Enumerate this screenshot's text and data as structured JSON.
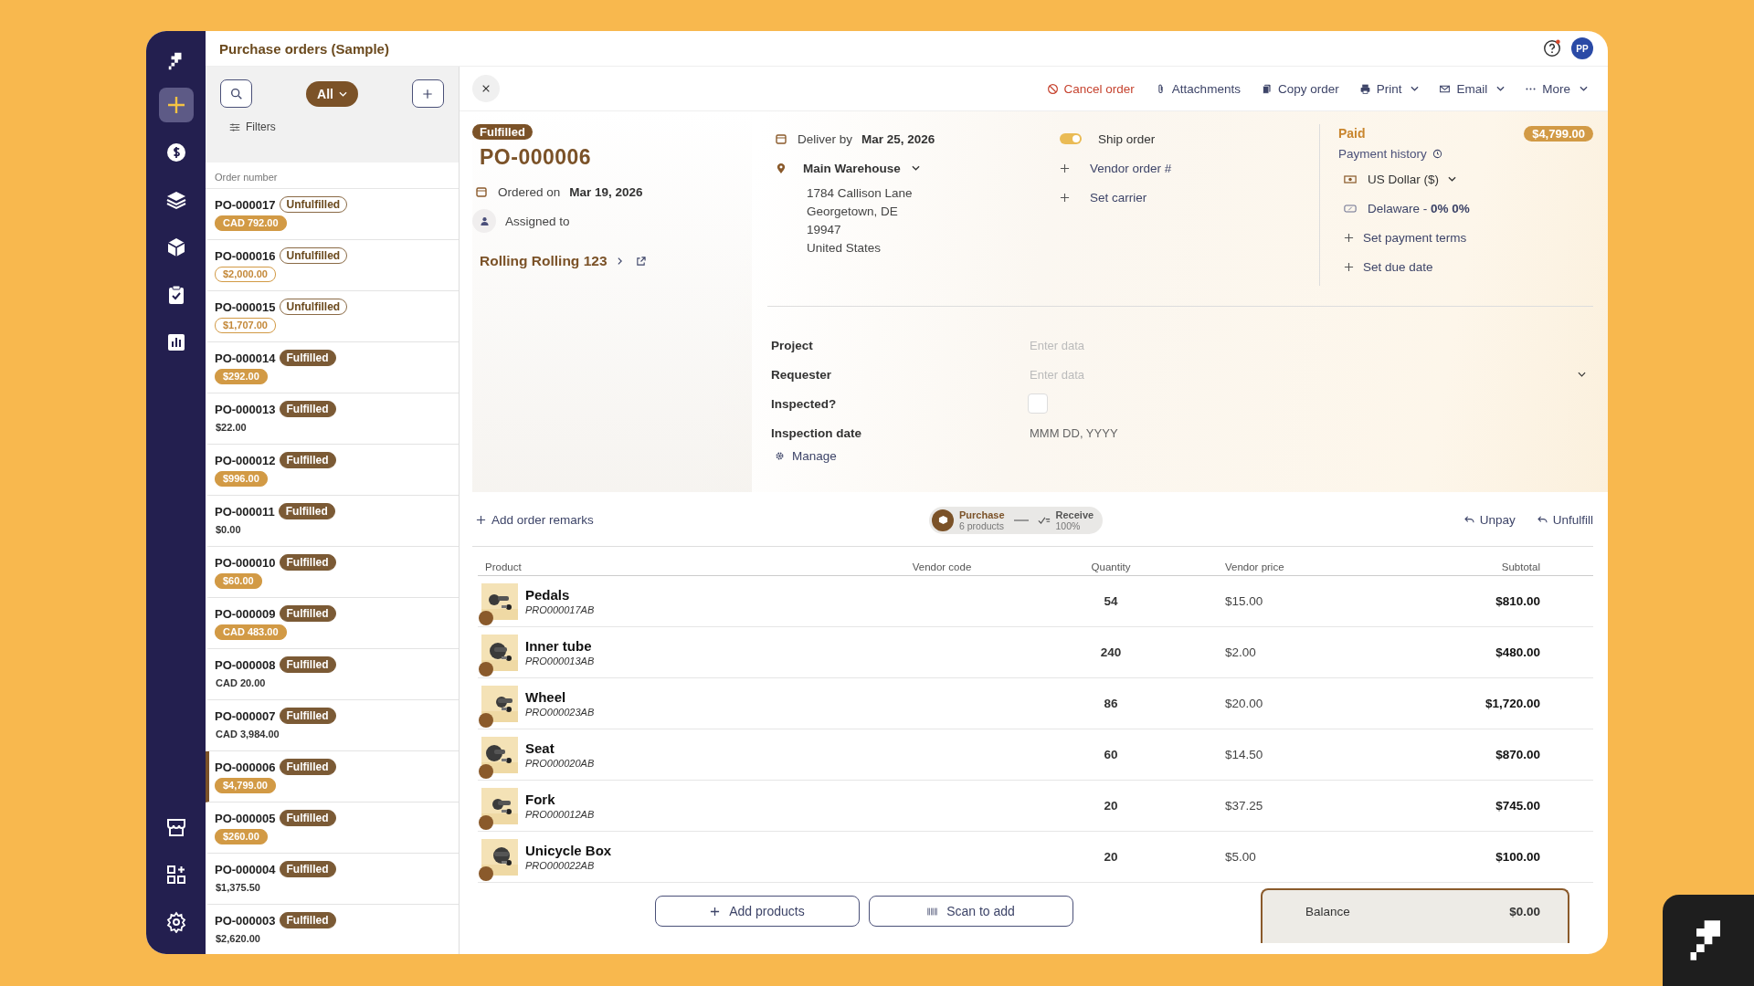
{
  "app": {
    "title": "Purchase orders (Sample)",
    "avatar": "PP"
  },
  "nav": [
    {
      "kind": "add",
      "selected": true
    },
    {
      "kind": "money",
      "selected": false
    },
    {
      "kind": "layers",
      "selected": false
    },
    {
      "kind": "box",
      "selected": false
    },
    {
      "kind": "clipboard",
      "selected": false
    },
    {
      "kind": "chart",
      "selected": false
    }
  ],
  "nav_bottom": [
    {
      "kind": "store",
      "selected": false
    },
    {
      "kind": "apps",
      "selected": false
    },
    {
      "kind": "settings",
      "selected": false
    }
  ],
  "list": {
    "filter": "All",
    "filters_label": "Filters",
    "column": "Order number",
    "orders": [
      {
        "number": "PO-000017",
        "status": "Unfulfilled",
        "fulfilled": false,
        "amount": {
          "text": "CAD 792.00",
          "kind": "solid"
        },
        "selected": false
      },
      {
        "number": "PO-000016",
        "status": "Unfulfilled",
        "fulfilled": false,
        "amount": {
          "text": "$2,000.00",
          "kind": "outline"
        },
        "selected": false
      },
      {
        "number": "PO-000015",
        "status": "Unfulfilled",
        "fulfilled": false,
        "amount": {
          "text": "$1,707.00",
          "kind": "outline"
        },
        "selected": false
      },
      {
        "number": "PO-000014",
        "status": "Fulfilled",
        "fulfilled": true,
        "amount": {
          "text": "$292.00",
          "kind": "solid"
        },
        "selected": false
      },
      {
        "number": "PO-000013",
        "status": "Fulfilled",
        "fulfilled": true,
        "amount": {
          "text": "$22.00",
          "kind": "plain"
        },
        "selected": false
      },
      {
        "number": "PO-000012",
        "status": "Fulfilled",
        "fulfilled": true,
        "amount": {
          "text": "$996.00",
          "kind": "solid"
        },
        "selected": false
      },
      {
        "number": "PO-000011",
        "status": "Fulfilled",
        "fulfilled": true,
        "amount": {
          "text": "$0.00",
          "kind": "plain"
        },
        "selected": false
      },
      {
        "number": "PO-000010",
        "status": "Fulfilled",
        "fulfilled": true,
        "amount": {
          "text": "$60.00",
          "kind": "solid"
        },
        "selected": false
      },
      {
        "number": "PO-000009",
        "status": "Fulfilled",
        "fulfilled": true,
        "amount": {
          "text": "CAD 483.00",
          "kind": "solid"
        },
        "selected": false
      },
      {
        "number": "PO-000008",
        "status": "Fulfilled",
        "fulfilled": true,
        "amount": {
          "text": "CAD 20.00",
          "kind": "plain"
        },
        "selected": false
      },
      {
        "number": "PO-000007",
        "status": "Fulfilled",
        "fulfilled": true,
        "amount": {
          "text": "CAD 3,984.00",
          "kind": "plain"
        },
        "selected": false
      },
      {
        "number": "PO-000006",
        "status": "Fulfilled",
        "fulfilled": true,
        "amount": {
          "text": "$4,799.00",
          "kind": "solid"
        },
        "selected": true
      },
      {
        "number": "PO-000005",
        "status": "Fulfilled",
        "fulfilled": true,
        "amount": {
          "text": "$260.00",
          "kind": "solid"
        },
        "selected": false
      },
      {
        "number": "PO-000004",
        "status": "Fulfilled",
        "fulfilled": true,
        "amount": {
          "text": "$1,375.50",
          "kind": "plain"
        },
        "selected": false
      },
      {
        "number": "PO-000003",
        "status": "Fulfilled",
        "fulfilled": true,
        "amount": {
          "text": "$2,620.00",
          "kind": "plain"
        },
        "selected": false
      }
    ]
  },
  "toolbar": [
    {
      "label": "Cancel order",
      "kind": "cancel",
      "dropdown": false
    },
    {
      "label": "Attachments",
      "kind": "attach",
      "dropdown": false
    },
    {
      "label": "Copy order",
      "kind": "copy",
      "dropdown": false
    },
    {
      "label": "Print",
      "kind": "print",
      "dropdown": true
    },
    {
      "label": "Email",
      "kind": "email",
      "dropdown": true
    },
    {
      "label": "More",
      "kind": "more",
      "dropdown": true
    }
  ],
  "order": {
    "status": "Fulfilled",
    "number": "PO-000006",
    "ordered_label": "Ordered on",
    "ordered_date": "Mar 19, 2026",
    "assigned": "Assigned to",
    "vendor": "Rolling Rolling 123"
  },
  "delivery": {
    "label": "Deliver by",
    "date": "Mar 25, 2026",
    "warehouse": "Main Warehouse",
    "address": [
      "1784 Callison Lane",
      "Georgetown, DE",
      "19947",
      "United States"
    ]
  },
  "shipping": {
    "ship_label": "Ship order",
    "ship_on": true,
    "links": [
      "Vendor order #",
      "Set carrier"
    ]
  },
  "payment": {
    "status": "Paid",
    "amount": "$4,799.00",
    "history": "Payment history",
    "currency": "US Dollar ($)",
    "tax": "Delaware - **0% 0%**",
    "links": [
      "Set payment terms",
      "Set due date"
    ]
  },
  "fields": [
    {
      "label": "Project",
      "kind": "text",
      "placeholder": "Enter data"
    },
    {
      "label": "Requester",
      "kind": "select",
      "placeholder": "Enter data"
    },
    {
      "label": "Inspected?",
      "kind": "checkbox",
      "checked": false
    },
    {
      "label": "Inspection date",
      "kind": "date",
      "placeholder": "MMM DD, YYYY"
    }
  ],
  "manage": "Manage",
  "remarks": "Add order remarks",
  "steps": [
    {
      "kind": "purchase",
      "title": "Purchase",
      "sub": "6 products"
    },
    {
      "kind": "receive",
      "title": "Receive",
      "sub": "100%"
    }
  ],
  "undo_actions": [
    "Unpay",
    "Unfulfill"
  ],
  "table": {
    "columns": [
      "Product",
      "Vendor code",
      "Quantity",
      "Vendor price",
      "Subtotal"
    ],
    "rows": [
      {
        "name": "Pedals",
        "code": "PRO000017AB",
        "quantity": "54",
        "price": "$15.00",
        "subtotal": "$810.00"
      },
      {
        "name": "Inner tube",
        "code": "PRO000013AB",
        "quantity": "240",
        "price": "$2.00",
        "subtotal": "$480.00"
      },
      {
        "name": "Wheel",
        "code": "PRO000023AB",
        "quantity": "86",
        "price": "$20.00",
        "subtotal": "$1,720.00"
      },
      {
        "name": "Seat",
        "code": "PRO000020AB",
        "quantity": "60",
        "price": "$14.50",
        "subtotal": "$870.00"
      },
      {
        "name": "Fork",
        "code": "PRO000012AB",
        "quantity": "20",
        "price": "$37.25",
        "subtotal": "$745.00"
      },
      {
        "name": "Unicycle Box",
        "code": "PRO000022AB",
        "quantity": "20",
        "price": "$5.00",
        "subtotal": "$100.00"
      }
    ]
  },
  "buttons": [
    {
      "label": "Add products",
      "kind": "add"
    },
    {
      "label": "Scan to add",
      "kind": "scan"
    }
  ],
  "balance": {
    "label": "Balance",
    "value": "$0.00"
  }
}
